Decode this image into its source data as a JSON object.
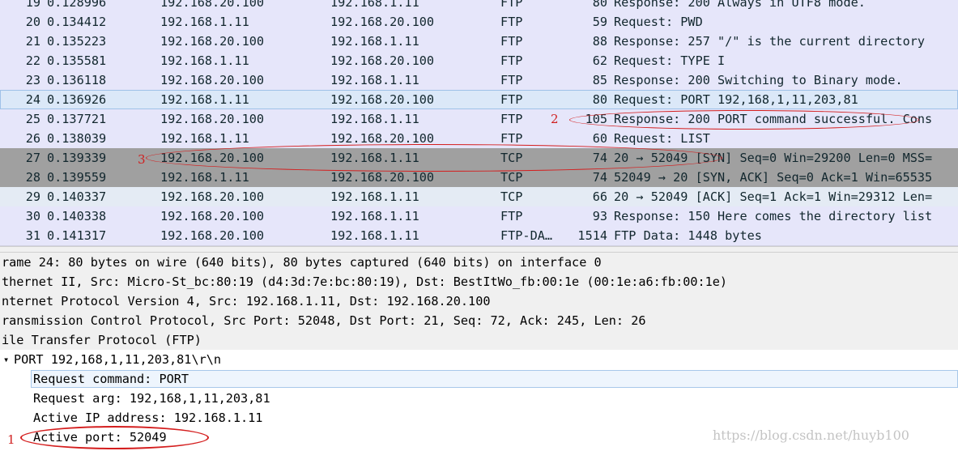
{
  "packets": [
    {
      "no": "19",
      "time": "0.128996",
      "src": "192.168.20.100",
      "dst": "192.168.1.11",
      "proto": "FTP",
      "len": "80",
      "info": "Response: 200 Always in UTF8 mode."
    },
    {
      "no": "20",
      "time": "0.134412",
      "src": "192.168.1.11",
      "dst": "192.168.20.100",
      "proto": "FTP",
      "len": "59",
      "info": "Request: PWD"
    },
    {
      "no": "21",
      "time": "0.135223",
      "src": "192.168.20.100",
      "dst": "192.168.1.11",
      "proto": "FTP",
      "len": "88",
      "info": "Response: 257 \"/\" is the current directory"
    },
    {
      "no": "22",
      "time": "0.135581",
      "src": "192.168.1.11",
      "dst": "192.168.20.100",
      "proto": "FTP",
      "len": "62",
      "info": "Request: TYPE I"
    },
    {
      "no": "23",
      "time": "0.136118",
      "src": "192.168.20.100",
      "dst": "192.168.1.11",
      "proto": "FTP",
      "len": "85",
      "info": "Response: 200 Switching to Binary mode."
    },
    {
      "no": "24",
      "time": "0.136926",
      "src": "192.168.1.11",
      "dst": "192.168.20.100",
      "proto": "FTP",
      "len": "80",
      "info": "Request: PORT 192,168,1,11,203,81"
    },
    {
      "no": "25",
      "time": "0.137721",
      "src": "192.168.20.100",
      "dst": "192.168.1.11",
      "proto": "FTP",
      "len": "105",
      "info": "Response: 200 PORT command successful. Cons"
    },
    {
      "no": "26",
      "time": "0.138039",
      "src": "192.168.1.11",
      "dst": "192.168.20.100",
      "proto": "FTP",
      "len": "60",
      "info": "Request: LIST"
    },
    {
      "no": "27",
      "time": "0.139339",
      "src": "192.168.20.100",
      "dst": "192.168.1.11",
      "proto": "TCP",
      "len": "74",
      "info": "20 → 52049 [SYN] Seq=0 Win=29200 Len=0 MSS="
    },
    {
      "no": "28",
      "time": "0.139559",
      "src": "192.168.1.11",
      "dst": "192.168.20.100",
      "proto": "TCP",
      "len": "74",
      "info": "52049 → 20 [SYN, ACK] Seq=0 Ack=1 Win=65535"
    },
    {
      "no": "29",
      "time": "0.140337",
      "src": "192.168.20.100",
      "dst": "192.168.1.11",
      "proto": "TCP",
      "len": "66",
      "info": "20 → 52049 [ACK] Seq=1 Ack=1 Win=29312 Len="
    },
    {
      "no": "30",
      "time": "0.140338",
      "src": "192.168.20.100",
      "dst": "192.168.1.11",
      "proto": "FTP",
      "len": "93",
      "info": "Response: 150 Here comes the directory list"
    },
    {
      "no": "31",
      "time": "0.141317",
      "src": "192.168.20.100",
      "dst": "192.168.1.11",
      "proto": "FTP-DA…",
      "len": "1514",
      "info": "FTP Data: 1448 bytes"
    }
  ],
  "details": {
    "frame": "rame 24: 80 bytes on wire (640 bits), 80 bytes captured (640 bits) on interface 0",
    "ethernet": "thernet II, Src: Micro-St_bc:80:19 (d4:3d:7e:bc:80:19), Dst: BestItWo_fb:00:1e (00:1e:a6:fb:00:1e)",
    "ip": "nternet Protocol Version 4, Src: 192.168.1.11, Dst: 192.168.20.100",
    "tcp": "ransmission Control Protocol, Src Port: 52048, Dst Port: 21, Seq: 72, Ack: 245, Len: 26",
    "ftp": "ile Transfer Protocol (FTP)",
    "port_line": "PORT 192,168,1,11,203,81\\r\\n",
    "expand_glyph": "▾",
    "request_command": "Request command: PORT",
    "request_arg": "Request arg: 192,168,1,11,203,81",
    "active_ip": "Active IP address: 192.168.1.11",
    "active_port": "Active port: 52049"
  },
  "annotations": {
    "a1": "1",
    "a2": "2",
    "a3": "3"
  },
  "watermark": "https://blog.csdn.net/huyb100",
  "colors": {
    "ftp_row": "#e6e6fa",
    "tcp_row": "#e4ebf4",
    "selected_row": "#dbe8f8",
    "dark_row": "#a0a0a0",
    "annotation_red": "#d41e1e"
  }
}
